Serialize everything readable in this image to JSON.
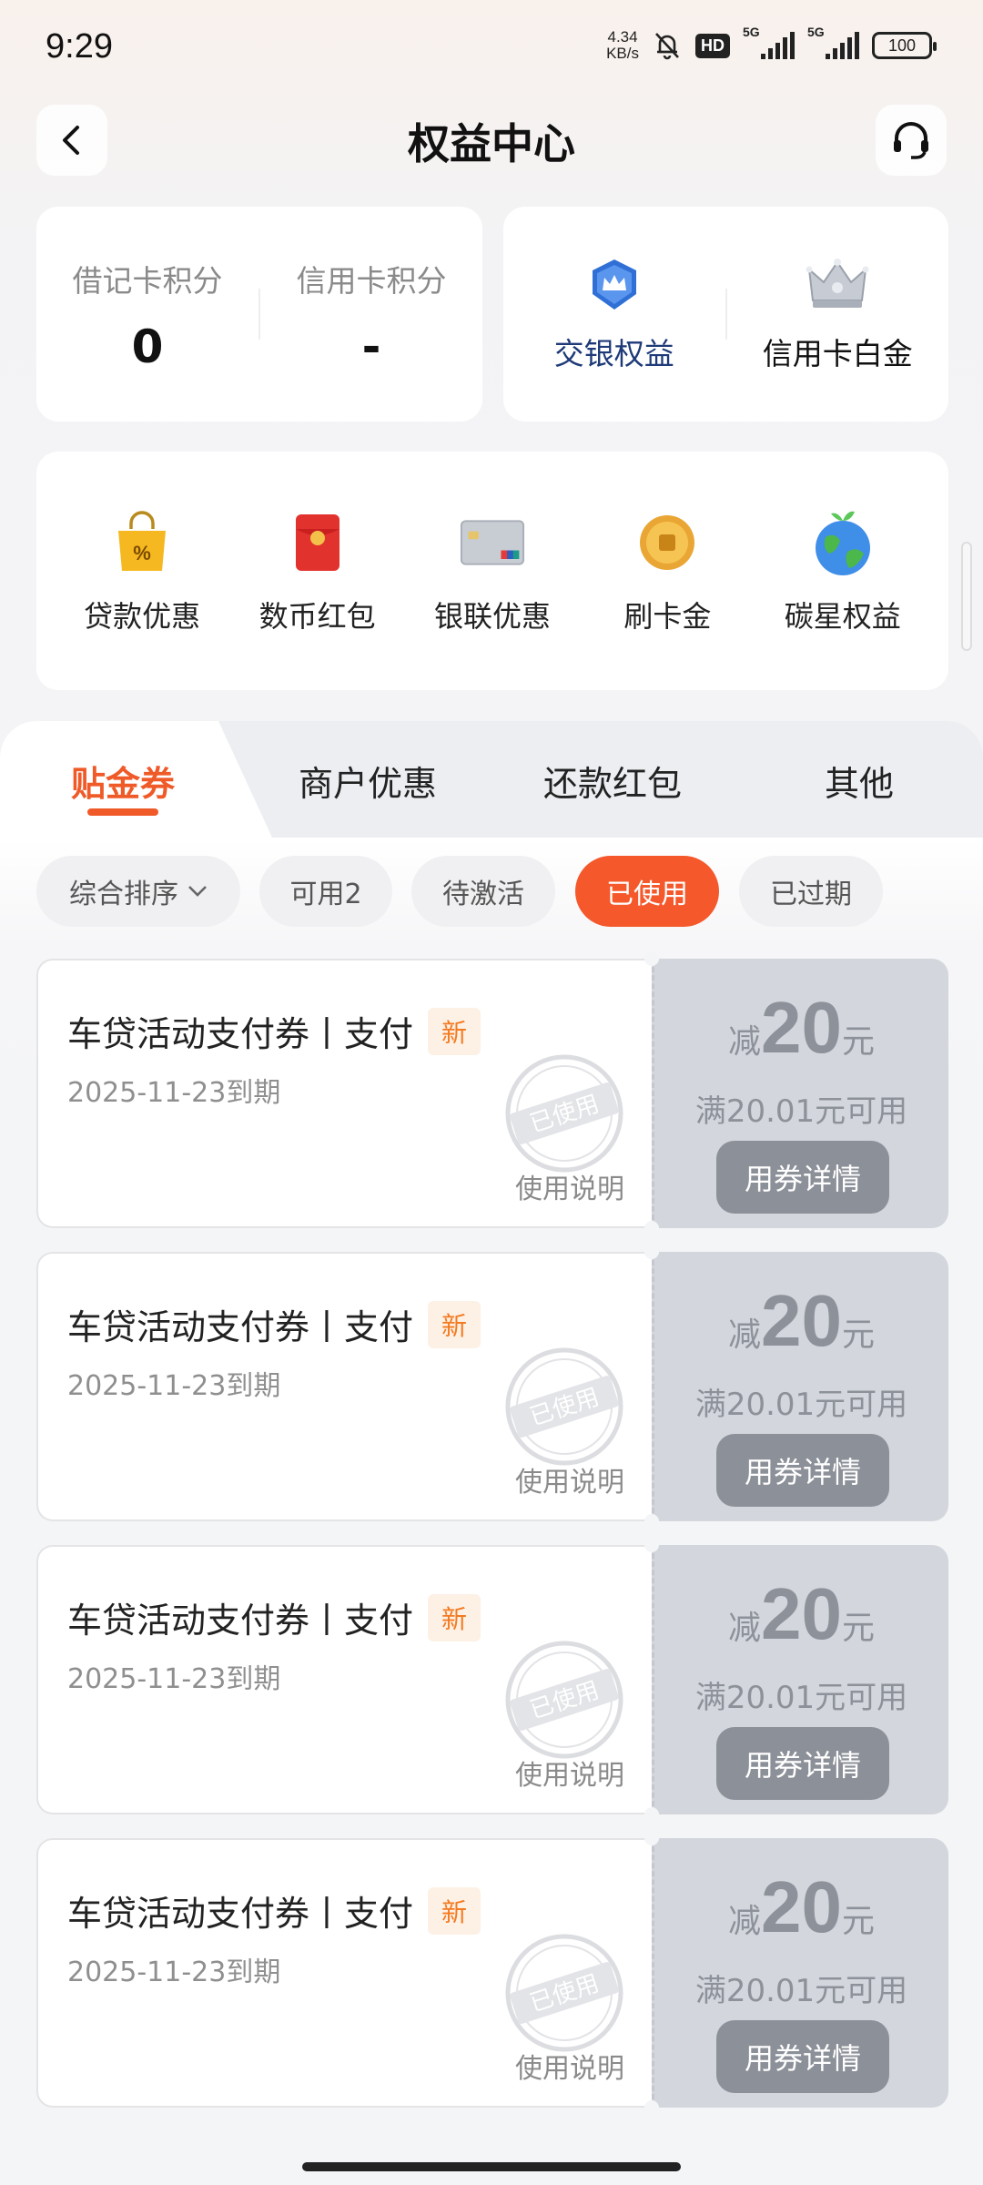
{
  "status_bar": {
    "time": "9:29",
    "net_speed_value": "4.34",
    "net_speed_unit": "KB/s",
    "hd_label": "HD",
    "signal1_label": "5G",
    "signal2_label": "5G",
    "battery": "100"
  },
  "header": {
    "title": "权益中心"
  },
  "points": {
    "debit_label": "借记卡积分",
    "debit_value": "0",
    "credit_label": "信用卡积分",
    "credit_value": "-"
  },
  "rights": {
    "bocom_label": "交银权益",
    "credit_platinum_label": "信用卡白金"
  },
  "services": [
    {
      "label": "贷款优惠",
      "icon": "shopping-bag-icon"
    },
    {
      "label": "数币红包",
      "icon": "red-envelope-icon"
    },
    {
      "label": "银联优惠",
      "icon": "unionpay-card-icon"
    },
    {
      "label": "刷卡金",
      "icon": "gold-coin-icon"
    },
    {
      "label": "碳星权益",
      "icon": "earth-icon"
    }
  ],
  "tabs": [
    {
      "label": "贴金券",
      "active": true
    },
    {
      "label": "商户优惠",
      "active": false
    },
    {
      "label": "还款红包",
      "active": false
    },
    {
      "label": "其他",
      "active": false
    }
  ],
  "filters": [
    {
      "label": "综合排序"
    },
    {
      "label": "可用2"
    },
    {
      "label": "待激活"
    },
    {
      "label": "已使用",
      "active": true
    },
    {
      "label": "已过期"
    }
  ],
  "coupons": [
    {
      "title": "车贷活动支付券丨支付",
      "tag": "新",
      "expiry": "2025-11-23到期",
      "usage": "使用说明",
      "prefix": "减",
      "amount": "20",
      "unit": "元",
      "condition": "满20.01元可用",
      "button": "用券详情",
      "stamp": "已使用"
    },
    {
      "title": "车贷活动支付券丨支付",
      "tag": "新",
      "expiry": "2025-11-23到期",
      "usage": "使用说明",
      "prefix": "减",
      "amount": "20",
      "unit": "元",
      "condition": "满20.01元可用",
      "button": "用券详情",
      "stamp": "已使用"
    },
    {
      "title": "车贷活动支付券丨支付",
      "tag": "新",
      "expiry": "2025-11-23到期",
      "usage": "使用说明",
      "prefix": "减",
      "amount": "20",
      "unit": "元",
      "condition": "满20.01元可用",
      "button": "用券详情",
      "stamp": "已使用"
    },
    {
      "title": "车贷活动支付券丨支付",
      "tag": "新",
      "expiry": "2025-11-23到期",
      "usage": "使用说明",
      "prefix": "减",
      "amount": "20",
      "unit": "元",
      "condition": "满20.01元可用",
      "button": "用券详情",
      "stamp": "已使用"
    }
  ],
  "colors": {
    "accent": "#f4582b",
    "tab_active": "#ef5a28",
    "coupon_right_bg": "#d3d6dc",
    "button_gray": "#8c9098"
  }
}
